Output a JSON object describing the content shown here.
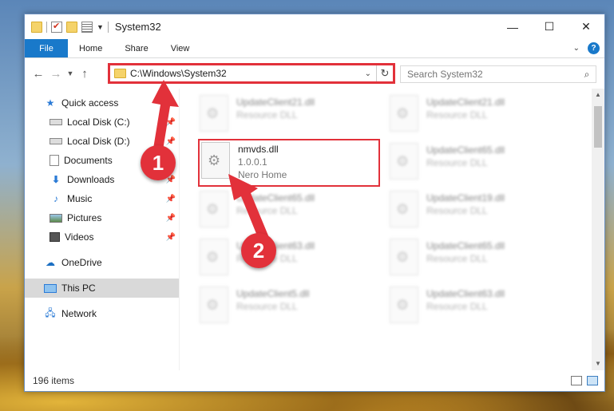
{
  "window": {
    "title": "System32",
    "controls": {
      "minimize": "—",
      "maximize": "☐",
      "close": "✕"
    }
  },
  "ribbon": {
    "tabs": [
      "File",
      "Home",
      "Share",
      "View"
    ]
  },
  "address": {
    "path": "C:\\Windows\\System32",
    "search_placeholder": "Search System32"
  },
  "sidebar": {
    "items": [
      {
        "label": "Quick access",
        "icon": "star-icon"
      },
      {
        "label": "Local Disk (C:)",
        "icon": "drive-icon"
      },
      {
        "label": "Local Disk (D:)",
        "icon": "drive-icon"
      },
      {
        "label": "Documents",
        "icon": "documents-icon"
      },
      {
        "label": "Downloads",
        "icon": "download-icon"
      },
      {
        "label": "Music",
        "icon": "music-icon"
      },
      {
        "label": "Pictures",
        "icon": "pictures-icon"
      },
      {
        "label": "Videos",
        "icon": "videos-icon"
      },
      {
        "label": "OneDrive",
        "icon": "cloud-icon"
      },
      {
        "label": "This PC",
        "icon": "computer-icon"
      },
      {
        "label": "Network",
        "icon": "network-icon"
      }
    ]
  },
  "files": [
    {
      "name": "UpdateClient21.dll",
      "type": "Resource DLL"
    },
    {
      "name": "UpdateClient21.dll",
      "type": "Resource DLL"
    },
    {
      "name": "nmvds.dll",
      "version": "1.0.0.1",
      "company": "Nero Home"
    },
    {
      "name": "UpdateClient65.dll",
      "type": "Resource DLL"
    },
    {
      "name": "UpdateClient65.dll",
      "type": "Resource DLL"
    },
    {
      "name": "UpdateClient19.dll",
      "type": "Resource DLL"
    },
    {
      "name": "UpdateClient63.dll",
      "type": "Resource DLL"
    },
    {
      "name": "UpdateClient65.dll",
      "type": "Resource DLL"
    },
    {
      "name": "UpdateClient5.dll",
      "type": "Resource DLL"
    },
    {
      "name": "UpdateClient63.dll",
      "type": "Resource DLL"
    }
  ],
  "status": {
    "item_count": "196 items"
  },
  "annotations": {
    "step1": "1",
    "step2": "2",
    "color": "#e2313a"
  }
}
